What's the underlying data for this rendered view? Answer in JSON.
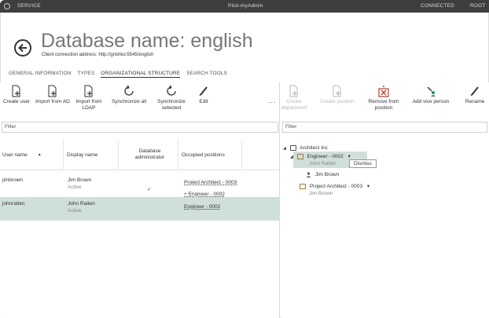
{
  "titlebar": {
    "service": "SERVICE",
    "app_name": "Pilot-myAdmin",
    "connection_status": "CONNECTED",
    "user": "ROOT"
  },
  "header": {
    "title": "Database name: english",
    "subtitle": "Client connection address: http://grishko:5545/english"
  },
  "tabs": [
    {
      "label": "GENERAL INFORMATION",
      "active": false
    },
    {
      "label": "TYPES",
      "active": false
    },
    {
      "label": "ORGANIZATIONAL STRUCTURE",
      "active": true
    },
    {
      "label": "SEARCH TOOLS",
      "active": false
    }
  ],
  "left_toolbar": {
    "create_user": "Create user",
    "import_ad": "Import from AD",
    "import_ldap_1": "Import from",
    "import_ldap_2": "LDAP",
    "sync_all": "Synchronize all",
    "sync_selected_1": "Synchronize",
    "sync_selected_2": "selected",
    "edit": "Edit",
    "more": "..."
  },
  "right_toolbar": {
    "create_dept_1": "Create",
    "create_dept_2": "department",
    "create_position": "Create position",
    "remove_position_1": "Remove from",
    "remove_position_2": "position",
    "add_vice": "Add vice person",
    "rename": "Rename"
  },
  "left_filter": {
    "placeholder": "Filter"
  },
  "right_filter": {
    "placeholder": "Filter"
  },
  "users_table": {
    "columns": {
      "user_name": "User name",
      "sort": "▲",
      "display_name": "Display name",
      "db_admin_1": "Database",
      "db_admin_2": "administrator",
      "positions": "Occupied positions"
    },
    "rows": [
      {
        "user_name": "jimbrown",
        "display_name": "Jim Brown",
        "status": "Active",
        "admin_mark": "✓",
        "position_1": "Project Architect - 0003",
        "position_2": "+ Engineer - 0002"
      },
      {
        "user_name": "johnraiten",
        "display_name": "John Raiten",
        "status": "Active",
        "admin_mark": "",
        "position_1": "Engineer - 0002"
      }
    ]
  },
  "org_tree": {
    "root": "Architect Inc",
    "nodes": [
      {
        "label": "Engineer - 0002",
        "person": "John Raiten",
        "action": "Dismiss",
        "vice": "Jim Brown"
      },
      {
        "label": "Project Architect - 0003",
        "person": "Jim Brown"
      }
    ],
    "dropdown_glyph": "▾"
  },
  "colors": {
    "titlebar": "#3e3e3e",
    "selection": "#cfdfdc",
    "disabled_text": "#b8b8b8"
  }
}
